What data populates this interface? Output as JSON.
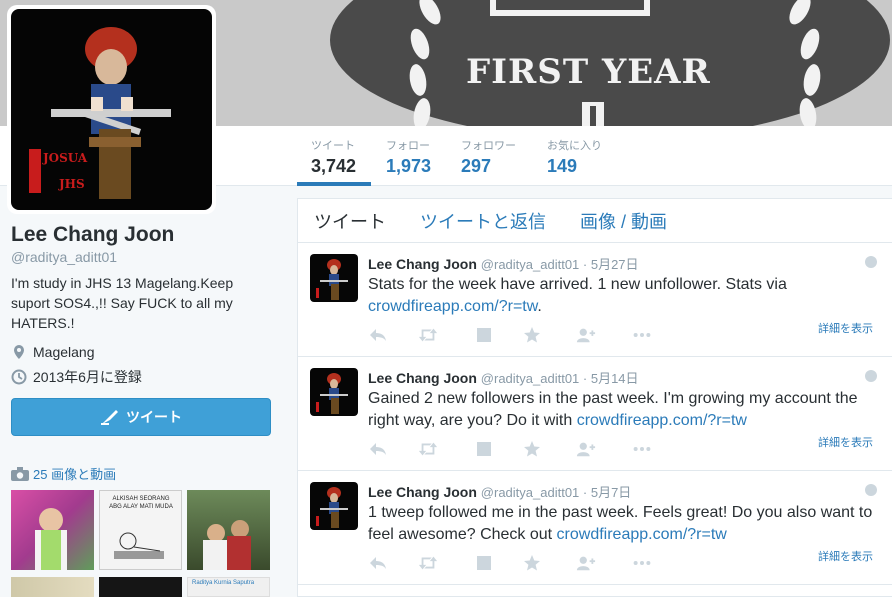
{
  "banner": {
    "text": "FIRST YEAR"
  },
  "profile_nav": {
    "stats": [
      {
        "label": "ツイート",
        "value": "3,742"
      },
      {
        "label": "フォロー",
        "value": "1,973"
      },
      {
        "label": "フォロワー",
        "value": "297"
      },
      {
        "label": "お気に入り",
        "value": "149"
      }
    ]
  },
  "avatar": {
    "caption_line1": "JOSUA",
    "caption_line2": "JHS"
  },
  "profile": {
    "name": "Lee Chang Joon",
    "handle": "@raditya_aditt01",
    "bio": "I'm study in JHS 13 Magelang.Keep suport SOS4.,!! Say FUCK to all my HATERS.!",
    "location": "Magelang",
    "joined": "2013年6月に登録",
    "tweet_button": "ツイート",
    "photos_link": "25 画像と動画"
  },
  "thumbs": {
    "t2_text": "ALKISAH SEORANG ABG ALAY MATI MUDA",
    "t6_text": "Raditya Kurnia Saputra"
  },
  "timeline": {
    "tabs": [
      "ツイート",
      "ツイートと返信",
      "画像 / 動画"
    ],
    "tweets": [
      {
        "name": "Lee Chang Joon",
        "handle": "@raditya_aditt01",
        "sep": " · ",
        "time": "5月27日",
        "text": "Stats for the week have arrived. 1 new unfollower. Stats via ",
        "link": "crowdfireapp.com/?r=tw",
        "tail": ".",
        "detail": "詳細を表示"
      },
      {
        "name": "Lee Chang Joon",
        "handle": "@raditya_aditt01",
        "sep": " · ",
        "time": "5月14日",
        "text": "Gained 2 new followers in the past week. I'm growing my account the right way, are you? Do it with ",
        "link": "crowdfireapp.com/?r=tw",
        "tail": "",
        "detail": "詳細を表示"
      },
      {
        "name": "Lee Chang Joon",
        "handle": "@raditya_aditt01",
        "sep": " · ",
        "time": "5月7日",
        "text": "1 tweep followed me in the past week. Feels great! Do you also want to feel awesome? Check out ",
        "link": "crowdfireapp.com/?r=tw",
        "tail": "",
        "detail": "詳細を表示"
      }
    ]
  },
  "colors": {
    "link": "#2b7bb9",
    "button": "#3fa0d7",
    "muted": "#8899a6",
    "text": "#292f33"
  }
}
